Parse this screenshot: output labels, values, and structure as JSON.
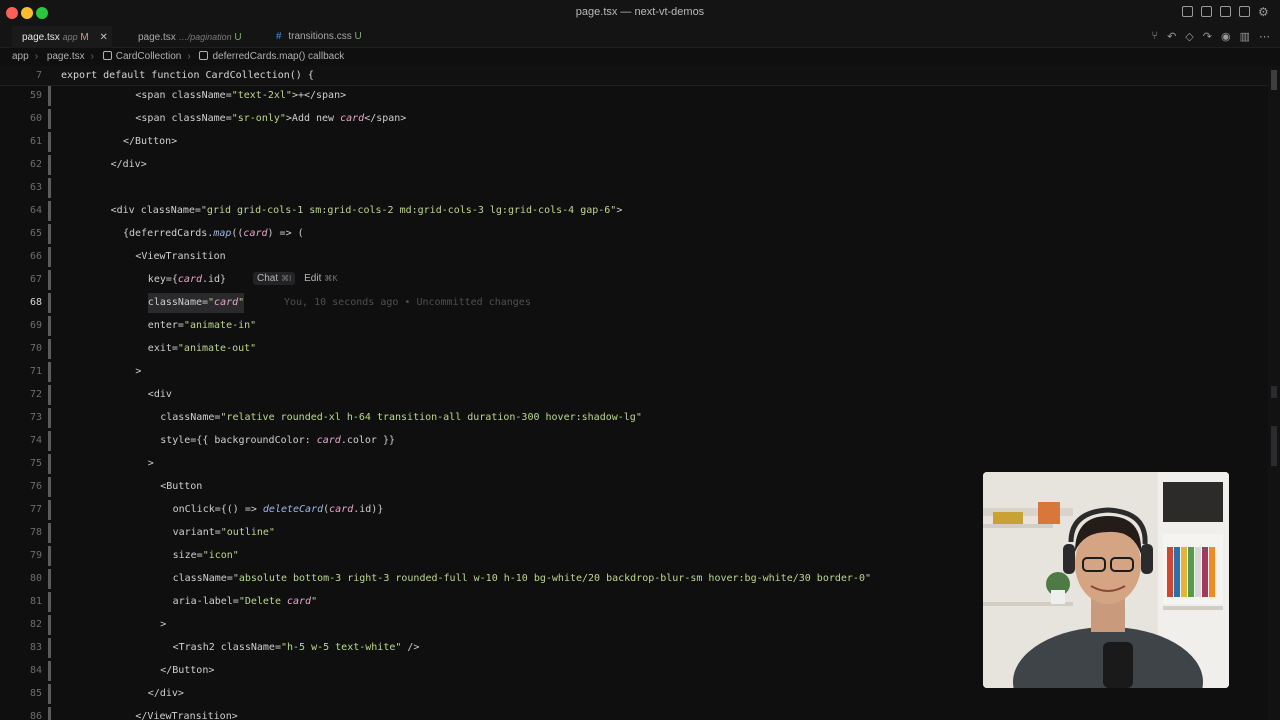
{
  "window": {
    "title": "page.tsx — next-vt-demos"
  },
  "tabs": [
    {
      "name": "page.tsx",
      "desc": "app",
      "status": "M",
      "active": true
    },
    {
      "name": "page.tsx",
      "desc": "…/pagination",
      "status": "U",
      "active": false
    },
    {
      "name": "transitions.css",
      "desc": "",
      "status": "U",
      "active": false
    }
  ],
  "breadcrumb": [
    "app",
    "page.tsx",
    "CardCollection",
    "deferredCards.map() callback"
  ],
  "sticky": {
    "line": "7",
    "text": "export default function CardCollection() {"
  },
  "inline_hint": {
    "chat": "Chat",
    "chat_key": "⌘I",
    "edit": "Edit",
    "edit_key": "⌘K"
  },
  "blame": "You, 10 seconds ago • Uncommitted changes",
  "current_line": "68",
  "lines": [
    {
      "n": "59",
      "t": "<span className=\"text-2xl\">+</span>"
    },
    {
      "n": "60",
      "t": "<span className=\"sr-only\">Add new card</span>"
    },
    {
      "n": "61",
      "t": "</Button>"
    },
    {
      "n": "62",
      "t": "</div>"
    },
    {
      "n": "63",
      "t": ""
    },
    {
      "n": "64",
      "t": "<div className=\"grid grid-cols-1 sm:grid-cols-2 md:grid-cols-3 lg:grid-cols-4 gap-6\">"
    },
    {
      "n": "65",
      "t": "{deferredCards.map((card) => ("
    },
    {
      "n": "66",
      "t": "<ViewTransition"
    },
    {
      "n": "67",
      "t": "key={card.id}"
    },
    {
      "n": "68",
      "t": "className=\"card\""
    },
    {
      "n": "69",
      "t": "enter=\"animate-in\""
    },
    {
      "n": "70",
      "t": "exit=\"animate-out\""
    },
    {
      "n": "71",
      "t": ">"
    },
    {
      "n": "72",
      "t": "<div"
    },
    {
      "n": "73",
      "t": "className=\"relative rounded-xl h-64 transition-all duration-300 hover:shadow-lg\""
    },
    {
      "n": "74",
      "t": "style={{ backgroundColor: card.color }}"
    },
    {
      "n": "75",
      "t": ">"
    },
    {
      "n": "76",
      "t": "<Button"
    },
    {
      "n": "77",
      "t": "onClick={() => deleteCard(card.id)}"
    },
    {
      "n": "78",
      "t": "variant=\"outline\""
    },
    {
      "n": "79",
      "t": "size=\"icon\""
    },
    {
      "n": "80",
      "t": "className=\"absolute bottom-3 right-3 rounded-full w-10 h-10 bg-white/20 backdrop-blur-sm hover:bg-white/30 border-0\""
    },
    {
      "n": "81",
      "t": "aria-label=\"Delete card\""
    },
    {
      "n": "82",
      "t": ">"
    },
    {
      "n": "83",
      "t": "<Trash2 className=\"h-5 w-5 text-white\" />"
    },
    {
      "n": "84",
      "t": "</Button>"
    },
    {
      "n": "85",
      "t": "</div>"
    },
    {
      "n": "86",
      "t": "</ViewTransition>"
    }
  ]
}
